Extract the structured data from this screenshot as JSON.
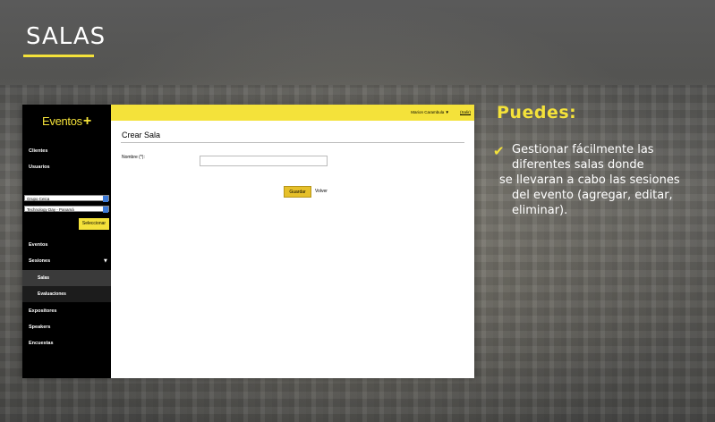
{
  "slide": {
    "title": "SALAS",
    "heading": "Puedes:",
    "description_lines": [
      "Gestionar fácilmente las",
      "diferentes salas donde",
      "se llevaran a cabo las sesiones",
      "del evento (agregar, editar,",
      "eliminar)."
    ],
    "colors": {
      "accent": "#f4e23a",
      "sidebar": "#000000",
      "background": "#5a5a5a"
    }
  },
  "app": {
    "logo": {
      "text": "Eventos",
      "plus": "+"
    },
    "topbar": {
      "user": "Marion Carambula ▼",
      "logout": "(Salir)"
    },
    "sidebar": {
      "items": [
        "Clientes",
        "Usuarios"
      ],
      "selects": [
        "Grupo Ceica",
        "Technology Day - Panamá"
      ],
      "select_button": "Seleccionar",
      "menu": [
        "Eventos",
        "Sesiones"
      ],
      "submenu": [
        "Salas",
        "Evaluaciones"
      ],
      "menu2": [
        "Expositores",
        "Speakers",
        "Encuestas"
      ],
      "active_submenu": "Salas"
    },
    "main": {
      "title": "Crear Sala",
      "field_label": "Nombre (*):",
      "field_value": "",
      "save_button": "Guardar",
      "back_link": "Volver"
    }
  }
}
